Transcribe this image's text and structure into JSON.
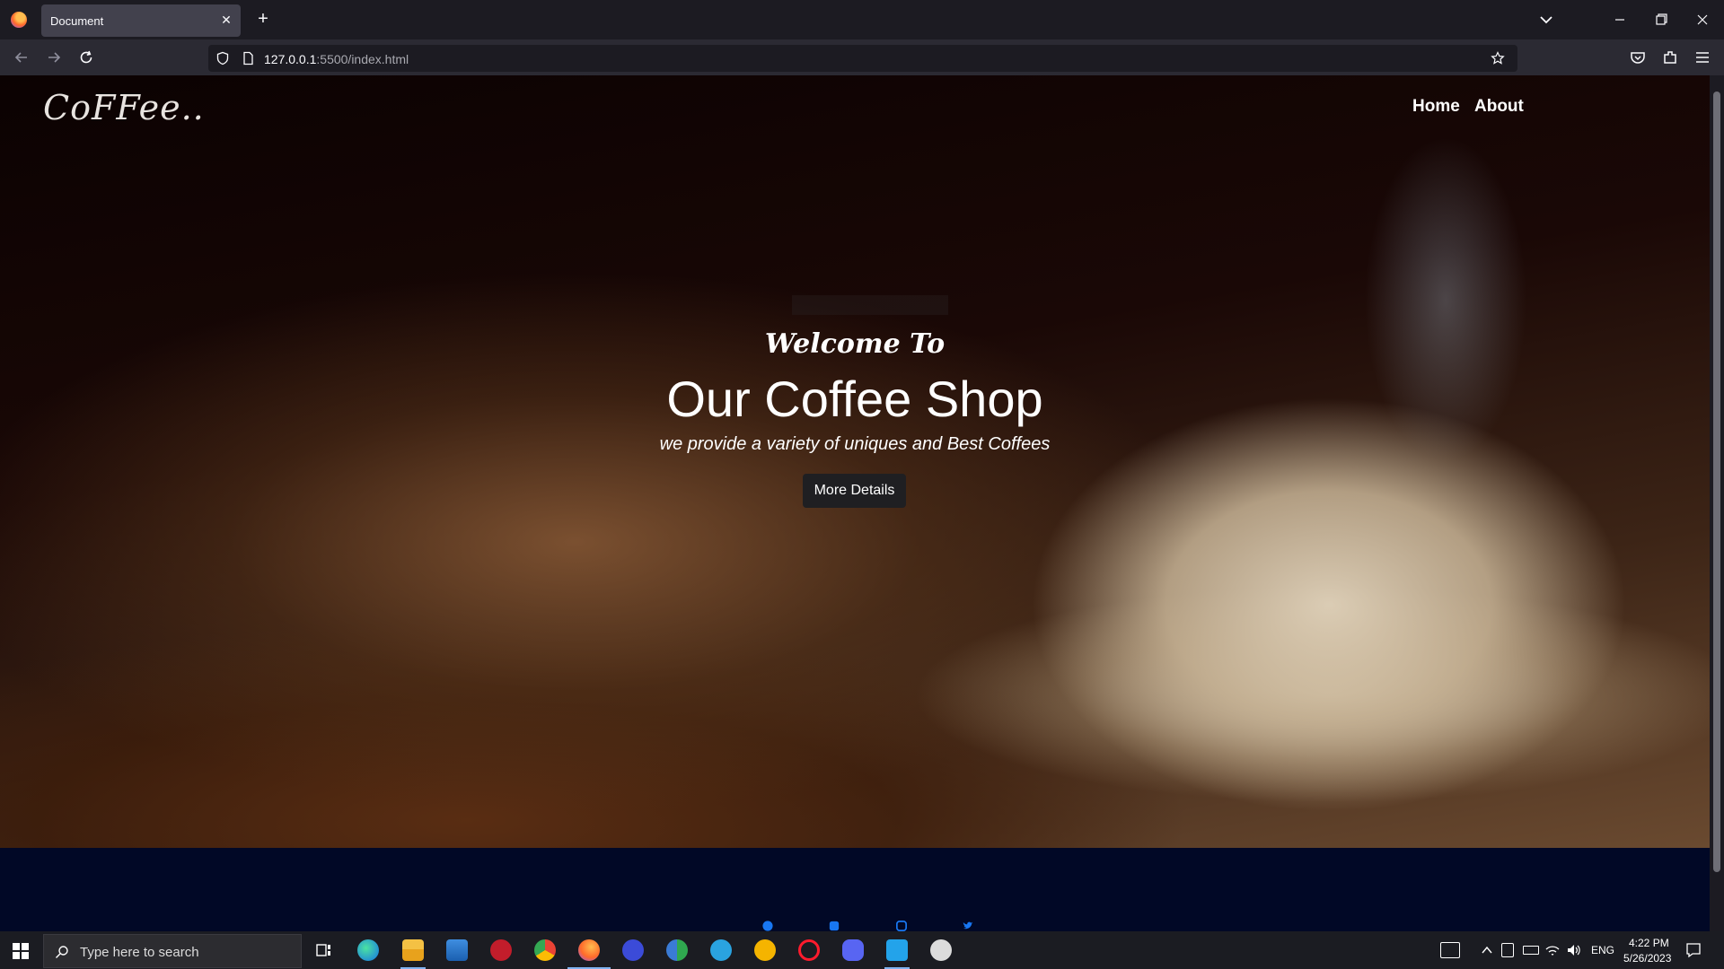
{
  "browser": {
    "tab_title": "Document",
    "url_host": "127.0.0.1",
    "url_path": ":5500/index.html"
  },
  "site": {
    "logo": "CoFFee..",
    "nav": [
      "Home",
      "About"
    ],
    "welcome": "Welcome To",
    "headline": "Our Coffee Shop",
    "subline": "we provide a variety of uniques and Best Coffees",
    "cta": "More Details"
  },
  "taskbar": {
    "search_placeholder": "Type here to search",
    "language": "ENG",
    "time": "4:22 PM",
    "date": "5/26/2023"
  },
  "colors": {
    "footer_bg": "#010826",
    "button_bg": "#1f1f22"
  }
}
